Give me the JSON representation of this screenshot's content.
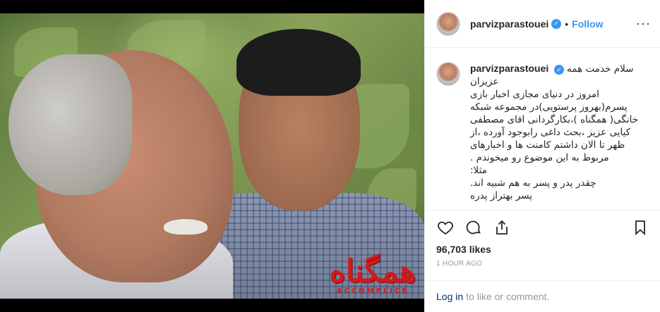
{
  "post": {
    "username": "parvizparastouei",
    "verified_badge": "✓",
    "separator": "•",
    "follow_label": "Follow",
    "more_icon": "···",
    "image_logo": {
      "title": "همگناه",
      "subtitle": "ACCOMPLICE"
    },
    "caption": {
      "username": "parvizparastouei",
      "first_line": "سلام خدمت همه",
      "body": "عزیزان\nامروز در دنیای مجازی اخبار بازی\nپسرم(بهروز پرستویی)در مجموعه شبکه\nخانگی( همگناه )،بکارگردانی اقای مصطفی\nکیایی عزیز ،بحث داغی رابوجود آورده ،از\nظهر تا الان داشتم کامنت ها و اخبارهای\nمربوط به این موضوع رو میخوندم .\nمثلا:\nچقدر پدر و پسر به هم شبیه اند.\nپسر بهتراز پدره"
    },
    "likes": "96,703 likes",
    "timestamp": "1 HOUR AGO",
    "footer": {
      "login_link": "Log in",
      "login_text": "to like or comment."
    }
  },
  "colors": {
    "accent": "#3897f0",
    "link": "#003569",
    "logo_red": "#d21a1a",
    "muted": "#999999"
  },
  "icons": [
    "heart-icon",
    "comment-icon",
    "share-icon",
    "bookmark-icon",
    "more-options-icon",
    "verified-badge-icon"
  ]
}
